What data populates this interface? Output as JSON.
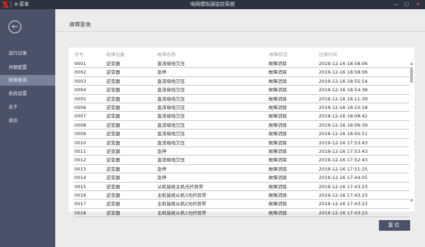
{
  "titlebar": {
    "menu_icon": "≡",
    "menu_label": "菜单",
    "app_title": "电网模拟源监控系统",
    "minimize": "—",
    "maximize": "▢",
    "close": "✕"
  },
  "sidebar": {
    "back_icon": "←",
    "items": [
      {
        "label": "运行记录"
      },
      {
        "label": "并联配置"
      },
      {
        "label": "故障查询",
        "active": true
      },
      {
        "label": "系统设置"
      },
      {
        "label": "关于"
      },
      {
        "label": "退出"
      }
    ]
  },
  "main": {
    "page_title": "故障查询",
    "columns": [
      "序号",
      "故障设备",
      "故障名称",
      "故障状态",
      "记录时间"
    ],
    "rows": [
      [
        "0001",
        "逆变器",
        "直流母线欠压",
        "故障消除",
        "2019-12-16 18:58:06"
      ],
      [
        "0002",
        "逆变器",
        "急停",
        "故障消除",
        "2019-12-16 18:58:06"
      ],
      [
        "0003",
        "逆变器",
        "直流母线欠压",
        "故障消除",
        "2019-12-16 18:55:54"
      ],
      [
        "0004",
        "逆变器",
        "直流母线欠压",
        "故障消除",
        "2019-12-16 18:54:38"
      ],
      [
        "0005",
        "逆变器",
        "直流母线欠压",
        "故障消除",
        "2019-12-16 18:11:39"
      ],
      [
        "0006",
        "逆变器",
        "直流母线欠压",
        "故障消除",
        "2019-12-16 18:10:18"
      ],
      [
        "0007",
        "逆变器",
        "直流母线欠压",
        "故障消除",
        "2019-12-16 18:08:42"
      ],
      [
        "0008",
        "逆变器",
        "直流母线欠压",
        "故障消除",
        "2019-12-16 18:06:39"
      ],
      [
        "0009",
        "逆变器",
        "直流母线欠压",
        "故障消除",
        "2019-12-16 18:05:51"
      ],
      [
        "0010",
        "逆变器",
        "直流母线欠压",
        "故障消除",
        "2019-12-16 17:53:43"
      ],
      [
        "0011",
        "逆变器",
        "急停",
        "故障消除",
        "2019-12-16 17:53:43"
      ],
      [
        "0012",
        "逆变器",
        "直流母线欠压",
        "故障消除",
        "2019-12-16 17:52:43"
      ],
      [
        "0013",
        "逆变器",
        "急停",
        "故障消除",
        "2019-12-16 17:51:15"
      ],
      [
        "0014",
        "逆变器",
        "急停",
        "故障消除",
        "2019-12-16 17:44:05"
      ],
      [
        "0015",
        "逆变器",
        "从机接收主机光纤异常",
        "故障消除",
        "2019-12-16 17:43:23"
      ],
      [
        "0016",
        "逆变器",
        "主机接收从机3光纤异常",
        "故障消除",
        "2019-12-16 17:43:23"
      ],
      [
        "0017",
        "逆变器",
        "主机接收从机2光纤异常",
        "故障消除",
        "2019-12-16 17:43:23"
      ],
      [
        "0018",
        "逆变器",
        "主机接收从机1光纤异常",
        "故障消除",
        "2019-12-16 17:43:23"
      ]
    ],
    "scroll_up": "▲",
    "scroll_down": "▼",
    "reset_label": "复位"
  },
  "colors": {
    "titlebar": "#2e3240",
    "sidebar": "#4a5169",
    "sidebar_active": "#7a819a",
    "logo_red": "#d9342b"
  }
}
